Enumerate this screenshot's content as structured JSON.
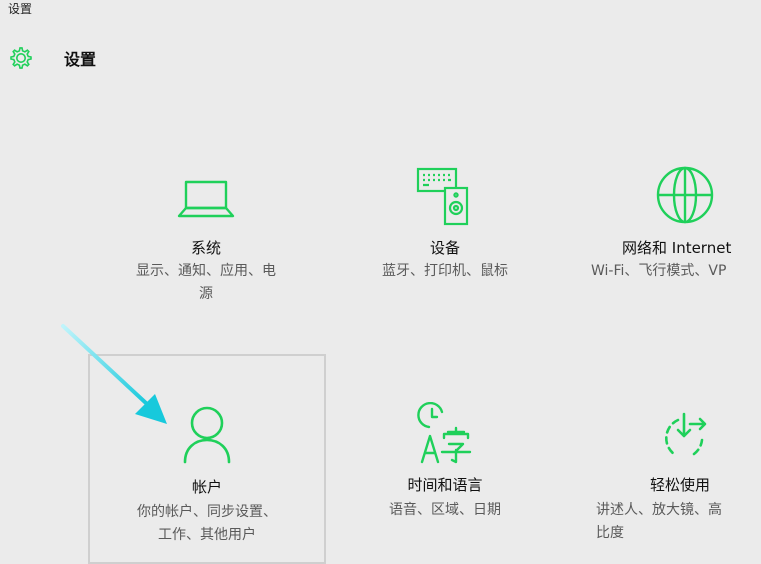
{
  "window": {
    "title": "设置"
  },
  "header": {
    "title": "设置",
    "icon": "gear-icon"
  },
  "accent_color": "#1fd05a",
  "tiles": [
    {
      "name": "系统",
      "desc": "显示、通知、应用、电\n源",
      "icon": "laptop-icon"
    },
    {
      "name": "设备",
      "desc": "蓝牙、打印机、鼠标",
      "icon": "devices-icon"
    },
    {
      "name": "网络和 Internet",
      "desc": "Wi-Fi、飞行模式、VP",
      "icon": "globe-icon"
    },
    {
      "name": "帐户",
      "desc": "你的帐户、同步设置、\n工作、其他用户",
      "icon": "person-icon"
    },
    {
      "name": "时间和语言",
      "desc": "语音、区域、日期",
      "icon": "time-language-icon"
    },
    {
      "name": "轻松使用",
      "desc": "讲述人、放大镜、高\n比度",
      "icon": "accessibility-icon"
    }
  ]
}
